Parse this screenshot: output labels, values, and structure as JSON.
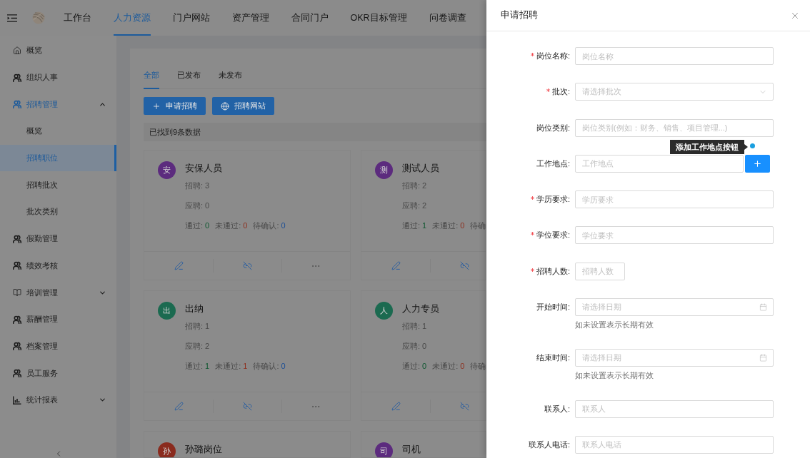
{
  "top_nav": {
    "items": [
      {
        "label": "工作台",
        "selected": false
      },
      {
        "label": "人力资源",
        "selected": true
      },
      {
        "label": "门户网站",
        "selected": false
      },
      {
        "label": "资产管理",
        "selected": false
      },
      {
        "label": "合同门户",
        "selected": false
      },
      {
        "label": "OKR目标管理",
        "selected": false
      },
      {
        "label": "问卷调查",
        "selected": false
      }
    ]
  },
  "sidebar": {
    "items": [
      {
        "label": "概览",
        "kind": "home",
        "selected": false
      },
      {
        "label": "组织人事",
        "kind": "people",
        "selected": false
      },
      {
        "label": "招聘管理",
        "kind": "people",
        "selected": true,
        "expanded": true,
        "children": [
          {
            "label": "概览",
            "selected": false
          },
          {
            "label": "招聘职位",
            "selected": true
          },
          {
            "label": "招聘批次",
            "selected": false
          },
          {
            "label": "批次类别",
            "selected": false
          }
        ]
      },
      {
        "label": "假勤管理",
        "kind": "people",
        "selected": false
      },
      {
        "label": "绩效考核",
        "kind": "people",
        "selected": false
      },
      {
        "label": "培训管理",
        "kind": "book",
        "selected": false,
        "expanded": false
      },
      {
        "label": "薪酬管理",
        "kind": "people",
        "selected": false
      },
      {
        "label": "档案管理",
        "kind": "people",
        "selected": false
      },
      {
        "label": "员工服务",
        "kind": "people",
        "selected": false
      },
      {
        "label": "统计报表",
        "kind": "chart",
        "selected": false,
        "expanded": false
      }
    ]
  },
  "tabs": [
    {
      "label": "全部",
      "selected": true
    },
    {
      "label": "已发布",
      "selected": false
    },
    {
      "label": "未发布",
      "selected": false
    }
  ],
  "toolbar": {
    "buttons": [
      {
        "label": "申请招聘",
        "kind": "add"
      },
      {
        "label": "招聘网站",
        "kind": "globe"
      }
    ]
  },
  "result_count": "已找到9条数据",
  "cards": [
    {
      "title": "安保人员",
      "avatar": "安",
      "color": "#5c2b7e",
      "lines": [
        "招聘: 3",
        "应聘: 0"
      ],
      "results": [
        {
          "kind": "passed",
          "label": "通过:",
          "value": "0"
        },
        {
          "kind": "failed",
          "label": "未通过:",
          "value": "0"
        },
        {
          "kind": "pending",
          "label": "待确认:",
          "value": "0"
        }
      ],
      "actions": [
        {
          "kind": "edit"
        },
        {
          "kind": "unlink"
        },
        {
          "kind": "more"
        }
      ]
    },
    {
      "title": "测试人员",
      "avatar": "测",
      "color": "#5c2b7e",
      "lines": [
        "招聘: 2",
        "应聘: 2"
      ],
      "results": [
        {
          "kind": "passed",
          "label": "通过:",
          "value": "1"
        },
        {
          "kind": "failed",
          "label": "未通过:",
          "value": "0"
        },
        {
          "label": "待确"
        }
      ],
      "actions": [
        {
          "kind": "edit"
        },
        {
          "kind": "unlink"
        }
      ]
    },
    {
      "title": "出纳",
      "avatar": "出",
      "color": "#1b6a50",
      "lines": [
        "招聘: 1",
        "应聘: 2"
      ],
      "results": [
        {
          "kind": "passed",
          "label": "通过:",
          "value": "1"
        },
        {
          "kind": "failed",
          "label": "未通过:",
          "value": "1"
        },
        {
          "kind": "pending",
          "label": "待确认:",
          "value": "0"
        }
      ],
      "actions": [
        {
          "kind": "edit"
        },
        {
          "kind": "unlink"
        },
        {
          "kind": "more"
        }
      ]
    },
    {
      "title": "人力专员",
      "avatar": "人",
      "color": "#1b6a50",
      "lines": [
        "招聘: 1",
        "应聘: 0"
      ],
      "results": [
        {
          "kind": "passed",
          "label": "通过:",
          "value": "0"
        },
        {
          "kind": "failed",
          "label": "未通过:",
          "value": "0"
        },
        {
          "label": "待确"
        }
      ],
      "actions": [
        {
          "kind": "edit"
        },
        {
          "kind": "unlink"
        }
      ]
    },
    {
      "title": "孙璐岗位",
      "avatar": "孙",
      "color": "#8a2b1e"
    },
    {
      "title": "司机",
      "avatar": "司",
      "color": "#5c2b7e"
    }
  ],
  "drawer": {
    "title": "申请招聘",
    "fields": [
      {
        "label": "岗位名称:",
        "required": true,
        "kind": "text",
        "placeholder": "岗位名称"
      },
      {
        "label": "批次:",
        "required": true,
        "kind": "select",
        "placeholder": "请选择批次"
      },
      {
        "label": "岗位类别:",
        "required": false,
        "kind": "text",
        "placeholder": "岗位类别(例如：财务、销售、项目管理...)"
      },
      {
        "label": "工作地点:",
        "required": false,
        "kind": "text_add",
        "placeholder": "工作地点",
        "tooltip": "添加工作地点按钮"
      },
      {
        "label": "学历要求:",
        "required": true,
        "kind": "text",
        "placeholder": "学历要求"
      },
      {
        "label": "学位要求:",
        "required": true,
        "kind": "text",
        "placeholder": "学位要求"
      },
      {
        "label": "招聘人数:",
        "required": true,
        "kind": "number",
        "placeholder": "招聘人数"
      },
      {
        "label": "开始时间:",
        "required": false,
        "kind": "date",
        "placeholder": "请选择日期",
        "help": "如未设置表示长期有效"
      },
      {
        "label": "结束时间:",
        "required": false,
        "kind": "date",
        "placeholder": "请选择日期",
        "help": "如未设置表示长期有效"
      },
      {
        "label": "联系人:",
        "required": false,
        "kind": "text",
        "placeholder": "联系人"
      },
      {
        "label": "联系人电话:",
        "required": false,
        "kind": "text",
        "placeholder": "联系人电话"
      }
    ]
  }
}
